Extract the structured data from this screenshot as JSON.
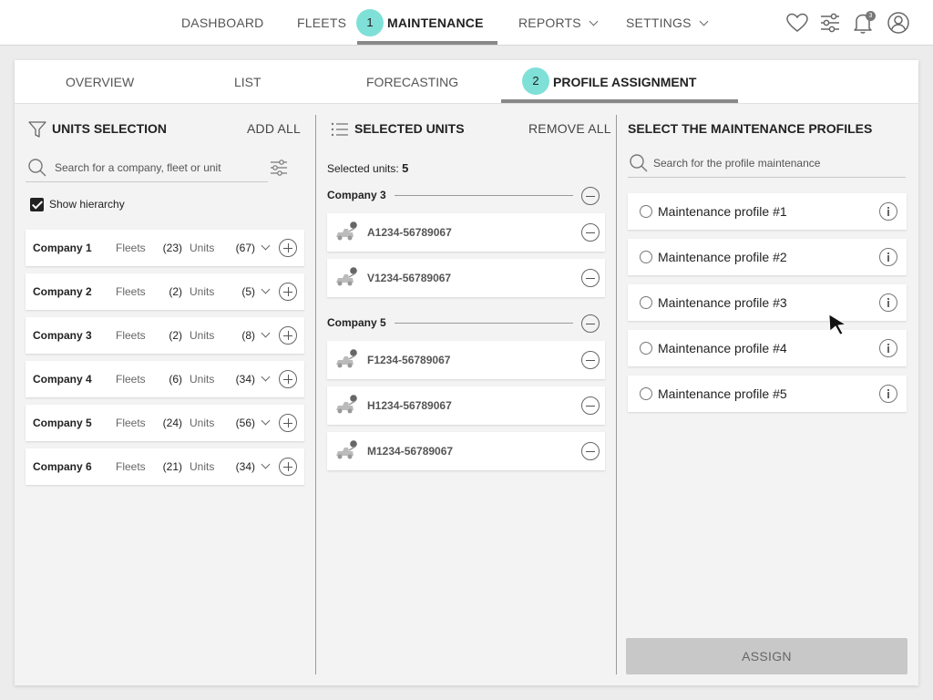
{
  "topnav": {
    "items": [
      {
        "label": "DASHBOARD"
      },
      {
        "label": "FLEETS"
      },
      {
        "label": "MAINTENANCE"
      },
      {
        "label": "REPORTS"
      },
      {
        "label": "SETTINGS"
      }
    ],
    "active": "MAINTENANCE",
    "step_badge": "1",
    "icons": [
      "heart-icon",
      "sliders-icon",
      "bell-icon",
      "user-icon"
    ],
    "notification_count": "3"
  },
  "subtabs": {
    "items": [
      {
        "label": "OVERVIEW"
      },
      {
        "label": "LIST"
      },
      {
        "label": "FORECASTING"
      },
      {
        "label": "PROFILE ASSIGNMENT"
      }
    ],
    "active": "PROFILE ASSIGNMENT",
    "step_badge": "2"
  },
  "units_selection": {
    "title": "UNITS SELECTION",
    "action": "ADD ALL",
    "search_placeholder": "Search for a company, fleet or unit",
    "show_hierarchy_label": "Show hierarchy",
    "show_hierarchy_checked": true,
    "fleets_label": "Fleets",
    "units_label": "Units",
    "companies": [
      {
        "name": "Company 1",
        "fleets": "(23)",
        "units": "(67)"
      },
      {
        "name": "Company 2",
        "fleets": "(2)",
        "units": "(5)"
      },
      {
        "name": "Company 3",
        "fleets": "(2)",
        "units": "(8)"
      },
      {
        "name": "Company 4",
        "fleets": "(6)",
        "units": "(34)"
      },
      {
        "name": "Company 5",
        "fleets": "(24)",
        "units": "(56)"
      },
      {
        "name": "Company 6",
        "fleets": "(21)",
        "units": "(34)"
      }
    ]
  },
  "selected_units": {
    "title": "SELECTED UNITS",
    "action": "REMOVE ALL",
    "count_label": "Selected units:",
    "count": "5",
    "groups": [
      {
        "name": "Company 3",
        "units": [
          "A1234-56789067",
          "V1234-56789067"
        ]
      },
      {
        "name": "Company 5",
        "units": [
          "F1234-56789067",
          "H1234-56789067",
          "M1234-56789067"
        ]
      }
    ]
  },
  "profiles": {
    "title": "SELECT THE MAINTENANCE PROFILES",
    "search_placeholder": "Search for the profile maintenance",
    "items": [
      {
        "label": "Maintenance profile #1"
      },
      {
        "label": "Maintenance profile #2"
      },
      {
        "label": "Maintenance profile #3"
      },
      {
        "label": "Maintenance profile #4"
      },
      {
        "label": "Maintenance profile #5"
      }
    ],
    "assign_label": "ASSIGN"
  }
}
